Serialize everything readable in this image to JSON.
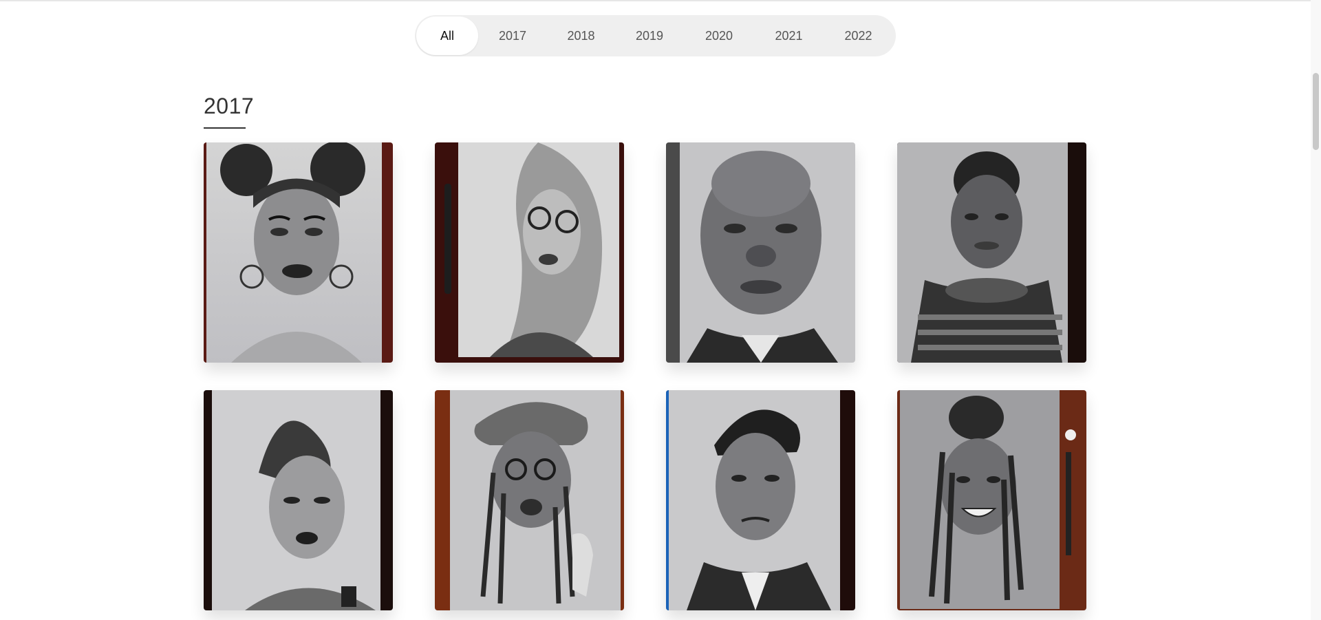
{
  "filter": {
    "tabs": [
      "All",
      "2017",
      "2018",
      "2019",
      "2020",
      "2021",
      "2022"
    ],
    "active": "All"
  },
  "section": {
    "title": "2017"
  },
  "gallery": {
    "items": [
      {
        "label": "portrait-woman-hoop-earrings"
      },
      {
        "label": "portrait-woman-glasses-long-hair"
      },
      {
        "label": "portrait-man-bald"
      },
      {
        "label": "portrait-woman-striped-shirt"
      },
      {
        "label": "portrait-woman-braided-hair"
      },
      {
        "label": "portrait-woman-headwrap-glasses"
      },
      {
        "label": "portrait-man-slicked-hair"
      },
      {
        "label": "portrait-woman-braids-smiling"
      }
    ]
  }
}
